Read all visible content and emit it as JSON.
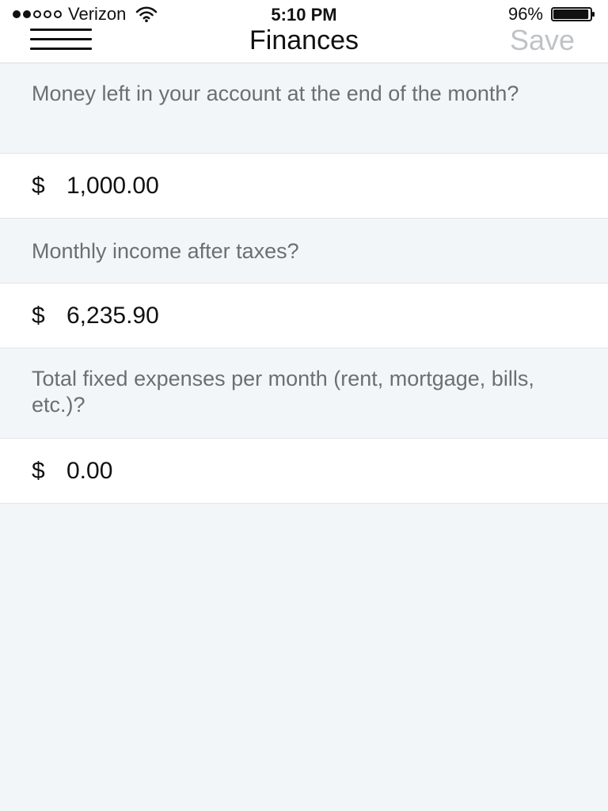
{
  "status_bar": {
    "carrier": "Verizon",
    "time": "5:10 PM",
    "battery_percent": "96%",
    "battery_level": 0.96,
    "signal_dots_filled": 2,
    "signal_dots_total": 5
  },
  "nav": {
    "menu_icon": "menu-icon",
    "title": "Finances",
    "save_label": "Save"
  },
  "form": {
    "questions": [
      {
        "prompt": "Money left in your account at the end of the month?",
        "currency_symbol": "$",
        "value": "1,000.00"
      },
      {
        "prompt": "Monthly income after taxes?",
        "currency_symbol": "$",
        "value": "6,235.90"
      },
      {
        "prompt": "Total fixed expenses per month (rent, mortgage, bills, etc.)?",
        "currency_symbol": "$",
        "value": "0.00"
      }
    ]
  },
  "colors": {
    "background": "#f3f6f9",
    "surface": "#ffffff",
    "divider": "#e1e5ea",
    "prompt_text": "#6b6f74",
    "save_disabled": "#bfc3c8",
    "text": "#111111"
  }
}
